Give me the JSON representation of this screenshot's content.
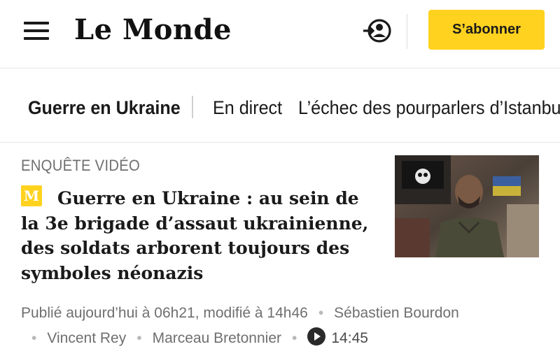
{
  "header": {
    "logo": "Le Monde",
    "subscribe_label": "S’abonner",
    "colors": {
      "accent": "#ffd21f"
    },
    "icons": {
      "menu": "hamburger-menu-icon",
      "login": "login-account-icon"
    }
  },
  "nav": {
    "items": [
      {
        "label": "Guerre en Ukraine"
      },
      {
        "label": "En direct"
      },
      {
        "label": "L’échec des pourparlers d’Istanbu"
      }
    ]
  },
  "article": {
    "kicker": "ENQUÊTE VIDÉO",
    "badge": "M",
    "headline": "Guerre en Ukraine : au sein de la 3e brigade d’assaut ukrainienne, des soldats arborent toujours des symboles néonazis",
    "published": "Publié aujourd’hui à 06h21, modifié à 14h46",
    "authors": [
      "Sébastien Bourdon",
      "Vincent Rey",
      "Marceau Bretonnier"
    ],
    "video_duration": "14:45"
  }
}
